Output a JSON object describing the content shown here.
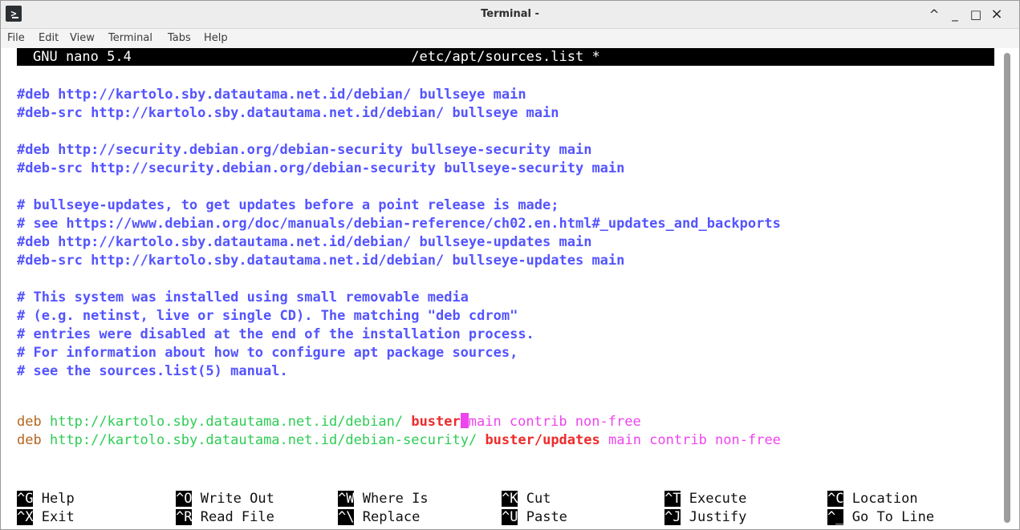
{
  "window": {
    "title": "Terminal -",
    "controls": {
      "shade": "^",
      "minimize": "_",
      "maximize": "□",
      "close": "×"
    }
  },
  "menubar": [
    "File",
    "Edit",
    "View",
    "Terminal",
    "Tabs",
    "Help"
  ],
  "nano": {
    "version": "GNU nano 5.4",
    "filename": "/etc/apt/sources.list *"
  },
  "lines": {
    "l1": "#deb http://kartolo.sby.datautama.net.id/debian/ bullseye main",
    "l2": "#deb-src http://kartolo.sby.datautama.net.id/debian/ bullseye main",
    "l4": "#deb http://security.debian.org/debian-security bullseye-security main",
    "l5": "#deb-src http://security.debian.org/debian-security bullseye-security main",
    "l7": "# bullseye-updates, to get updates before a point release is made;",
    "l8": "# see https://www.debian.org/doc/manuals/debian-reference/ch02.en.html#_updates_and_backports",
    "l9": "#deb http://kartolo.sby.datautama.net.id/debian/ bullseye-updates main",
    "l10": "#deb-src http://kartolo.sby.datautama.net.id/debian/ bullseye-updates main",
    "l12": "# This system was installed using small removable media",
    "l13": "# (e.g. netinst, live or single CD). The matching \"deb cdrom\"",
    "l14": "# entries were disabled at the end of the installation process.",
    "l15": "# For information about how to configure apt package sources,",
    "l16": "# see the sources.list(5) manual.",
    "l18": {
      "deb": "deb",
      "url": "http://kartolo.sby.datautama.net.id/debian/",
      "suite": "buster",
      "components": "main contrib non-free"
    },
    "l19": {
      "deb": "deb",
      "url": "http://kartolo.sby.datautama.net.id/debian-security/",
      "suite": "buster/updates",
      "components": "main contrib non-free"
    }
  },
  "shortcuts": [
    {
      "key": "^G",
      "label": "Help"
    },
    {
      "key": "^O",
      "label": "Write Out"
    },
    {
      "key": "^W",
      "label": "Where Is"
    },
    {
      "key": "^K",
      "label": "Cut"
    },
    {
      "key": "^T",
      "label": "Execute"
    },
    {
      "key": "^C",
      "label": "Location"
    },
    {
      "key": "^X",
      "label": "Exit"
    },
    {
      "key": "^R",
      "label": "Read File"
    },
    {
      "key": "^\\",
      "label": "Replace"
    },
    {
      "key": "^U",
      "label": "Paste"
    },
    {
      "key": "^J",
      "label": "Justify"
    },
    {
      "key": "^_",
      "label": "Go To Line"
    }
  ],
  "colors": {
    "comment": "#5454ff",
    "deb_keyword": "#b5651d",
    "url": "#2ecc55",
    "suite": "#ee2b2b",
    "components": "#ee44ee"
  }
}
